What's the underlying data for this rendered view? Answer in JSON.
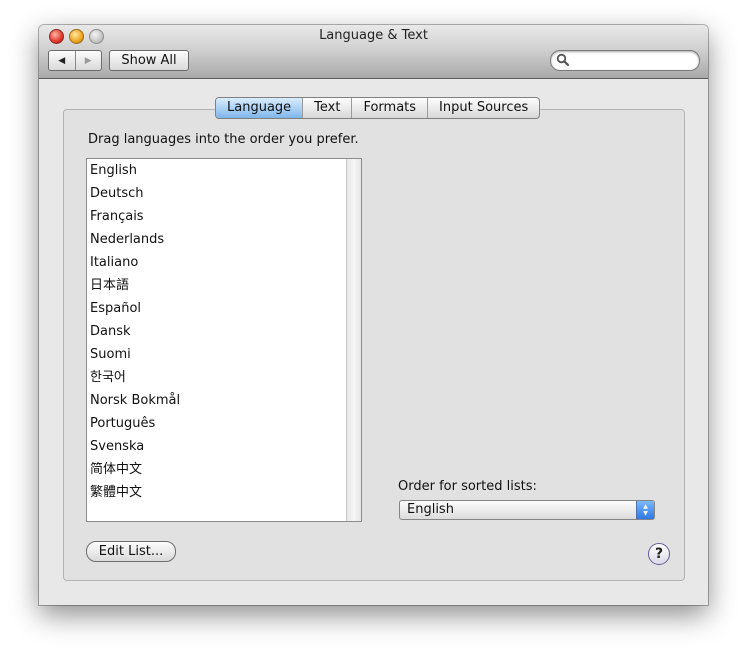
{
  "window": {
    "title": "Language & Text"
  },
  "toolbar": {
    "show_all": "Show All",
    "back_glyph": "◀",
    "forward_glyph": "▶"
  },
  "tabs": [
    {
      "label": "Language",
      "active": true
    },
    {
      "label": "Text",
      "active": false
    },
    {
      "label": "Formats",
      "active": false
    },
    {
      "label": "Input Sources",
      "active": false
    }
  ],
  "language_pane": {
    "instruction": "Drag languages into the order you prefer.",
    "languages": [
      "English",
      "Deutsch",
      "Français",
      "Nederlands",
      "Italiano",
      "日本語",
      "Español",
      "Dansk",
      "Suomi",
      "한국어",
      "Norsk Bokmål",
      "Português",
      "Svenska",
      "简体中文",
      "繁體中文"
    ],
    "sorted_lists_label": "Order for sorted lists:",
    "sorted_lists_value": "English",
    "edit_list_button": "Edit List...",
    "help_glyph": "?"
  }
}
